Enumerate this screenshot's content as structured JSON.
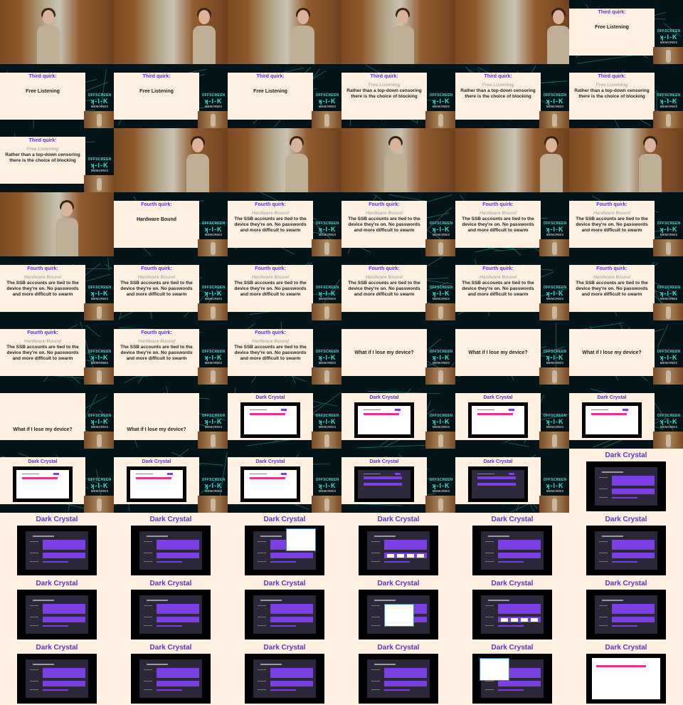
{
  "colors": {
    "accent": "#5a30e8",
    "card": "#fdf0e0",
    "pink_bar": "#e8308f",
    "purple_ui": "#7b3fe4",
    "logo": "#33e0d0"
  },
  "slide_texts": {
    "third_quirk": "Third quirk:",
    "free_listening": "Free Listening",
    "third_body": "Rather than a top-down censoring there is the choice of blocking",
    "fourth_quirk": "Fourth quirk:",
    "hardware_bound": "Hardware Bound",
    "fourth_body": "The SSB accounts are tied to the device they're on. No passwords and more difficult to swarm",
    "lose_device": "What if I lose my device?",
    "dark_crystal": "Dark Crystal"
  },
  "logo": {
    "line1": "OFFSCREEN",
    "line2": "ʞ-I-K",
    "line3": "MEMORIES"
  },
  "frames": [
    {
      "kind": "video"
    },
    {
      "kind": "video"
    },
    {
      "kind": "video"
    },
    {
      "kind": "video"
    },
    {
      "kind": "video"
    },
    {
      "kind": "slide",
      "variant": "t1"
    },
    {
      "kind": "slide",
      "variant": "t1"
    },
    {
      "kind": "slide",
      "variant": "t1"
    },
    {
      "kind": "slide",
      "variant": "t1"
    },
    {
      "kind": "slide",
      "variant": "t2"
    },
    {
      "kind": "slide",
      "variant": "t2"
    },
    {
      "kind": "slide",
      "variant": "t2"
    },
    {
      "kind": "slide",
      "variant": "t2"
    },
    {
      "kind": "video"
    },
    {
      "kind": "video"
    },
    {
      "kind": "video"
    },
    {
      "kind": "video"
    },
    {
      "kind": "video"
    },
    {
      "kind": "video"
    },
    {
      "kind": "slide",
      "variant": "f1"
    },
    {
      "kind": "slide",
      "variant": "f2"
    },
    {
      "kind": "slide",
      "variant": "f2"
    },
    {
      "kind": "slide",
      "variant": "f2"
    },
    {
      "kind": "slide",
      "variant": "f2"
    },
    {
      "kind": "slide",
      "variant": "f2"
    },
    {
      "kind": "slide",
      "variant": "f2"
    },
    {
      "kind": "slide",
      "variant": "f2"
    },
    {
      "kind": "slide",
      "variant": "f2"
    },
    {
      "kind": "slide",
      "variant": "f2"
    },
    {
      "kind": "slide",
      "variant": "f2"
    },
    {
      "kind": "slide",
      "variant": "f2"
    },
    {
      "kind": "slide",
      "variant": "f2"
    },
    {
      "kind": "slide",
      "variant": "f2"
    },
    {
      "kind": "slide",
      "variant": "q"
    },
    {
      "kind": "slide",
      "variant": "q"
    },
    {
      "kind": "slide",
      "variant": "q"
    },
    {
      "kind": "slide",
      "variant": "q2"
    },
    {
      "kind": "slide",
      "variant": "q2"
    },
    {
      "kind": "slide",
      "variant": "dcw"
    },
    {
      "kind": "slide",
      "variant": "dcw"
    },
    {
      "kind": "slide",
      "variant": "dcw"
    },
    {
      "kind": "slide",
      "variant": "dcw"
    },
    {
      "kind": "slide",
      "variant": "dcw"
    },
    {
      "kind": "slide",
      "variant": "dcw"
    },
    {
      "kind": "slide",
      "variant": "dcw"
    },
    {
      "kind": "slide",
      "variant": "dcp"
    },
    {
      "kind": "slide",
      "variant": "dcp"
    },
    {
      "kind": "full",
      "variant": "purple"
    },
    {
      "kind": "full",
      "variant": "purple"
    },
    {
      "kind": "full",
      "variant": "purple"
    },
    {
      "kind": "full",
      "variant": "popup"
    },
    {
      "kind": "full",
      "variant": "pills"
    },
    {
      "kind": "full",
      "variant": "purple"
    },
    {
      "kind": "full",
      "variant": "purple"
    },
    {
      "kind": "full",
      "variant": "purple"
    },
    {
      "kind": "full",
      "variant": "purple"
    },
    {
      "kind": "full",
      "variant": "purple"
    },
    {
      "kind": "full",
      "variant": "popup2"
    },
    {
      "kind": "full",
      "variant": "pills"
    },
    {
      "kind": "full",
      "variant": "purple"
    },
    {
      "kind": "full",
      "variant": "purple"
    },
    {
      "kind": "full",
      "variant": "purple"
    },
    {
      "kind": "full",
      "variant": "purple"
    },
    {
      "kind": "full",
      "variant": "purple"
    },
    {
      "kind": "full",
      "variant": "popup3"
    },
    {
      "kind": "full",
      "variant": "white"
    }
  ]
}
